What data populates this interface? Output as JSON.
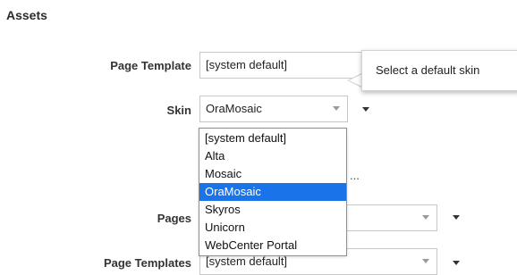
{
  "section": {
    "title": "Assets"
  },
  "page_template": {
    "label": "Page Template",
    "value": "[system default]"
  },
  "skin": {
    "label": "Skin",
    "value": "OraMosaic",
    "options": [
      {
        "label": "[system default]",
        "selected": false
      },
      {
        "label": "Alta",
        "selected": false
      },
      {
        "label": "Mosaic",
        "selected": false
      },
      {
        "label": "OraMosaic",
        "selected": true
      },
      {
        "label": "Skyros",
        "selected": false
      },
      {
        "label": "Unicorn",
        "selected": false
      },
      {
        "label": "WebCenter Portal",
        "selected": false
      }
    ]
  },
  "tooltip": {
    "text": "Select a default skin"
  },
  "obscured": {
    "ellipsis": "..."
  },
  "pages": {
    "label": "Pages"
  },
  "page_templates": {
    "label": "Page Templates",
    "value": "[system default]"
  },
  "icons": {
    "dropdown_chevron": "chevron-down-icon",
    "menu_caret": "caret-down-icon"
  },
  "colors": {
    "selected_option_bg": "#1a73e8",
    "selected_option_text": "#ffffff",
    "label_text": "#333333"
  }
}
